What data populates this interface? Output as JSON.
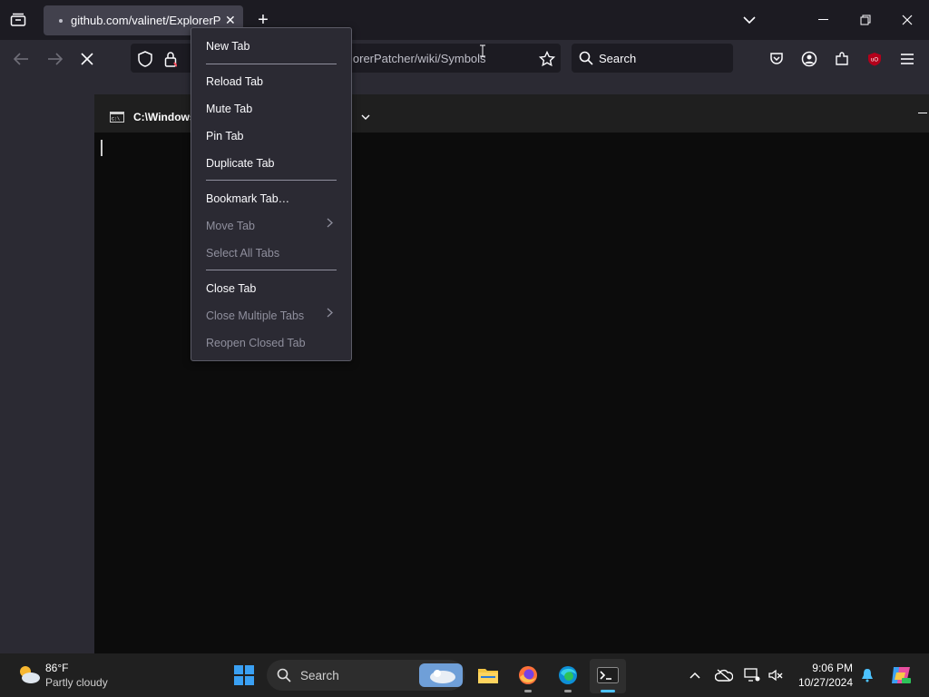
{
  "browser": {
    "tab_title": "github.com/valinet/ExplorerPatcher/wiki/Symbols",
    "url_visible": "lorerPatcher/wiki/Symbols",
    "search_placeholder": "Search",
    "colors": {
      "tabstrip": "#1c1b22",
      "toolbar": "#2b2a33",
      "tab": "#42414d"
    }
  },
  "terminal": {
    "tab_title": "C:\\Windows"
  },
  "context_menu": {
    "items": [
      {
        "label": "New Tab",
        "enabled": true
      },
      {
        "label": "Reload Tab",
        "enabled": true
      },
      {
        "label": "Mute Tab",
        "enabled": true
      },
      {
        "label": "Pin Tab",
        "enabled": true
      },
      {
        "label": "Duplicate Tab",
        "enabled": true
      },
      {
        "label": "Bookmark Tab…",
        "enabled": true
      },
      {
        "label": "Move Tab",
        "enabled": false,
        "submenu": true
      },
      {
        "label": "Select All Tabs",
        "enabled": false
      },
      {
        "label": "Close Tab",
        "enabled": true
      },
      {
        "label": "Close Multiple Tabs",
        "enabled": false,
        "submenu": true
      },
      {
        "label": "Reopen Closed Tab",
        "enabled": false
      }
    ]
  },
  "taskbar": {
    "weather_temp": "86°F",
    "weather_desc": "Partly cloudy",
    "search_placeholder": "Search",
    "time": "9:06 PM",
    "date": "10/27/2024",
    "icons": [
      "windows-start-icon",
      "file-explorer-icon",
      "firefox-icon",
      "edge-icon",
      "terminal-icon"
    ],
    "tray_icons": [
      "chevron-up-icon",
      "onedrive-icon",
      "network-icon",
      "volume-muted-icon",
      "notification-bell-icon",
      "copilot-icon"
    ]
  }
}
